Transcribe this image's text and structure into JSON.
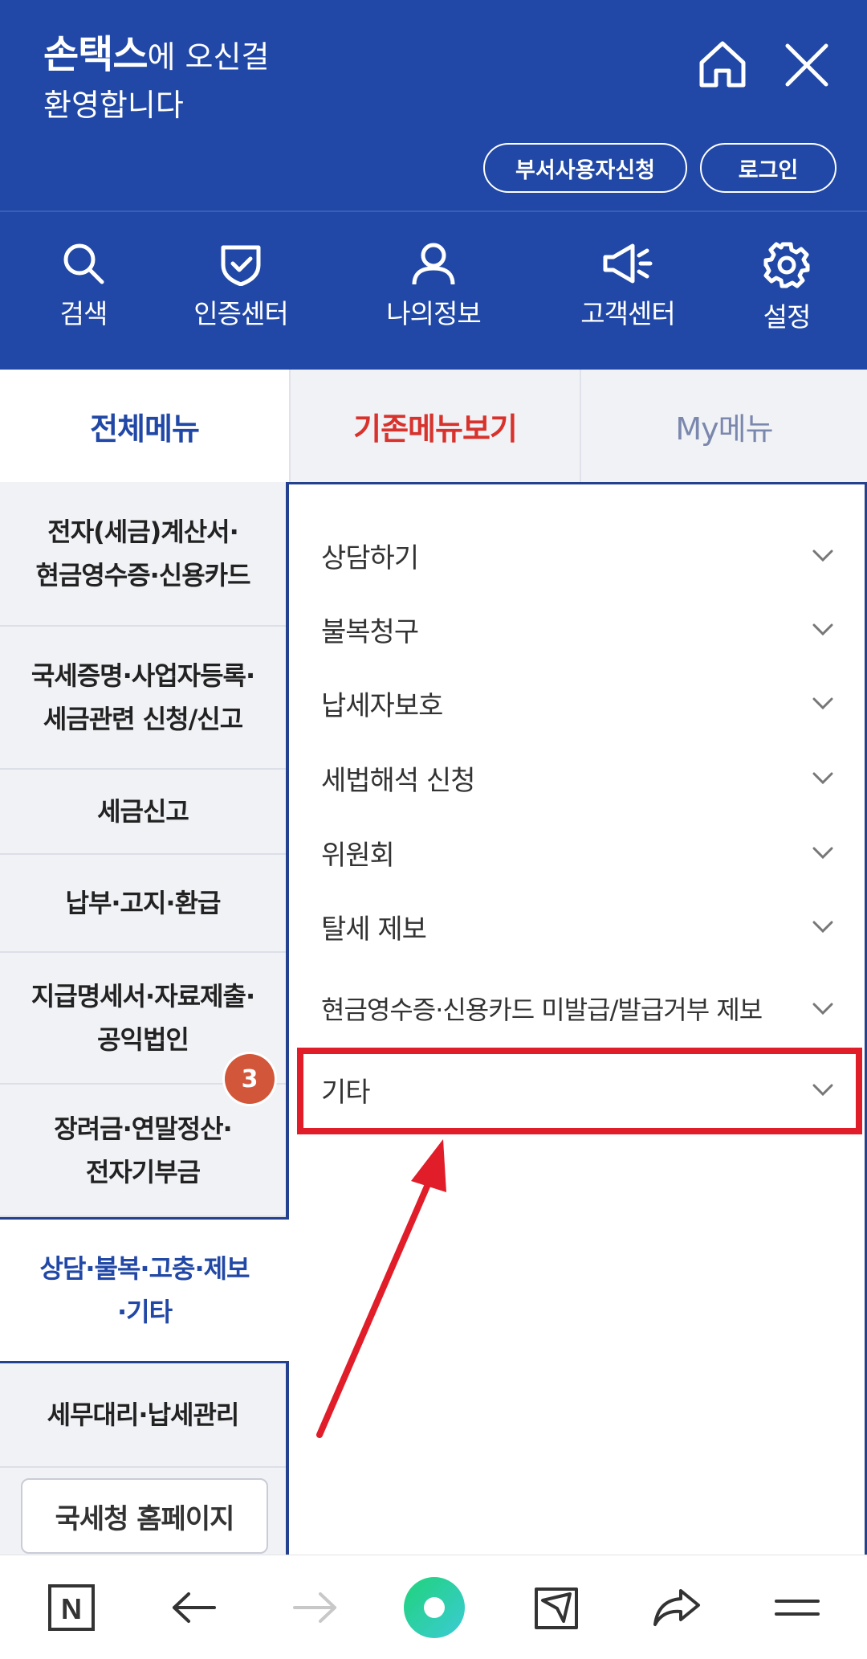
{
  "header": {
    "brand": "손택스",
    "welcome_suffix": "에 오신걸",
    "welcome_line2": "환영합니다",
    "dept_user_btn": "부서사용자신청",
    "login_btn": "로그인",
    "bg_color": "#2148a6"
  },
  "quick_menu": [
    {
      "label": "검색",
      "icon": "search-icon"
    },
    {
      "label": "인증센터",
      "icon": "shield-check-icon"
    },
    {
      "label": "나의정보",
      "icon": "person-icon"
    },
    {
      "label": "고객센터",
      "icon": "megaphone-icon"
    },
    {
      "label": "설정",
      "icon": "gear-icon"
    }
  ],
  "tabs": {
    "all": "전체메뉴",
    "legacy": "기존메뉴보기",
    "my": "My메뉴"
  },
  "categories": [
    "전자(세금)계산서·\n현금영수증·신용카드",
    "국세증명·사업자등록·\n세금관련 신청/신고",
    "세금신고",
    "납부·고지·환급",
    "지급명세서·자료제출·\n공익법인",
    "장려금·연말정산·\n전자기부금",
    "상담·불복·고충·제보\n·기타",
    "세무대리·납세관리"
  ],
  "home_link": "국세청 홈페이지",
  "submenu": [
    "상담하기",
    "불복청구",
    "납세자보호",
    "세법해석 신청",
    "위원회",
    "탈세 제보",
    "현금영수증·신용카드 미발급/발급거부 제보",
    "기타"
  ],
  "annotation": {
    "step": "3",
    "highlight_color": "#e11d2a"
  },
  "bottom_bar": {
    "naver_icon": "N"
  }
}
